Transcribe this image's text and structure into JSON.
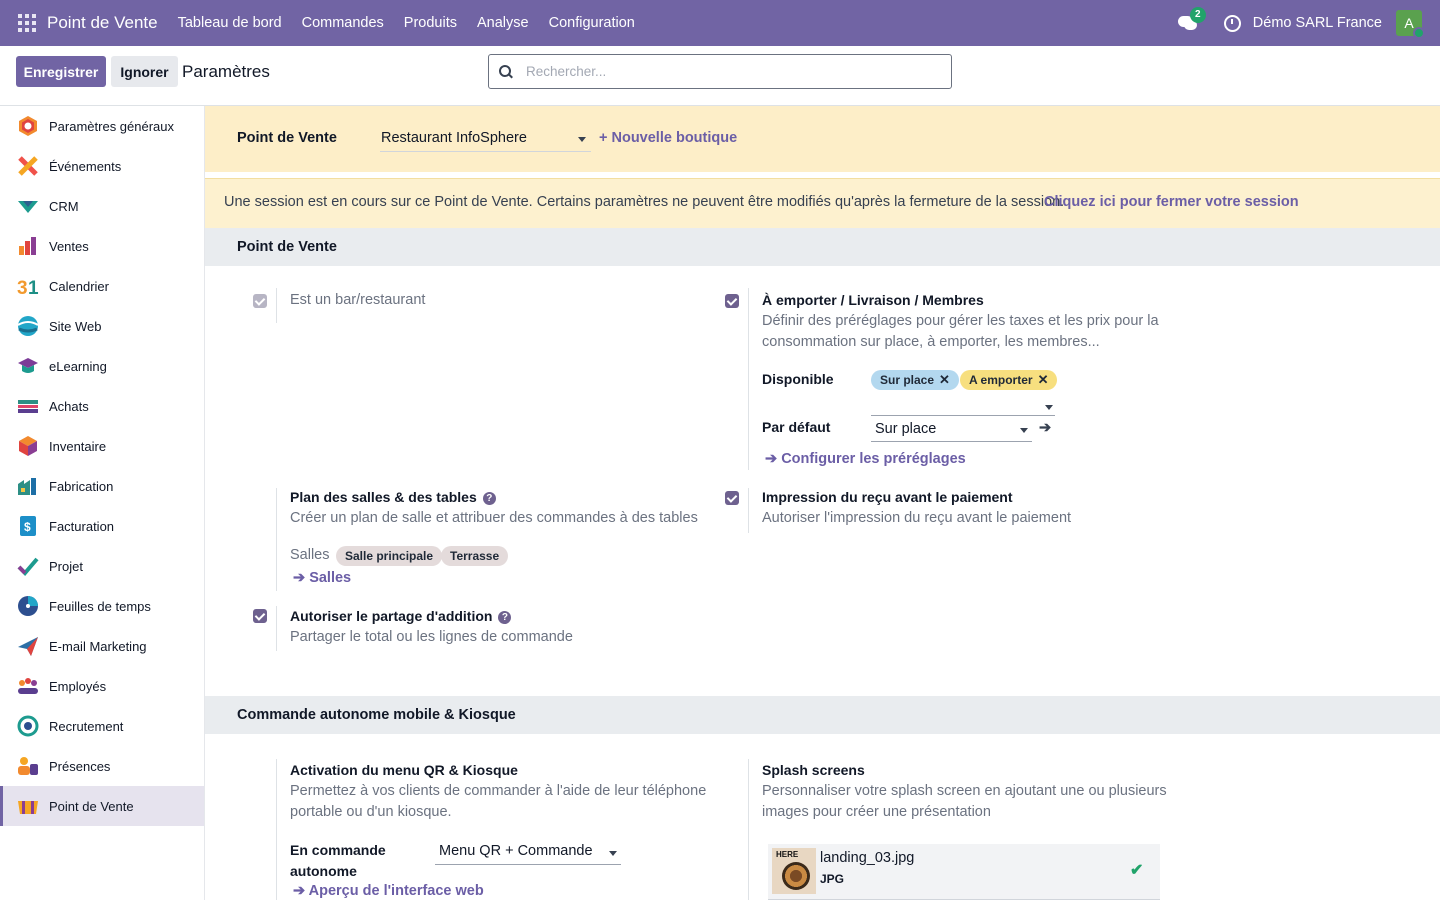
{
  "navbar": {
    "brand": "Point de Vente",
    "menu": [
      "Tableau de bord",
      "Commandes",
      "Produits",
      "Analyse",
      "Configuration"
    ],
    "chat_count": "2",
    "company": "Démo SARL France",
    "avatar_letter": "A"
  },
  "control": {
    "save_label": "Enregistrer",
    "ignore_label": "Ignorer",
    "title": "Paramètres",
    "search_placeholder": "Rechercher..."
  },
  "sidebar": {
    "items": [
      {
        "label": "Paramètres généraux",
        "icon": "settings-icon"
      },
      {
        "label": "Événements",
        "icon": "events-icon"
      },
      {
        "label": "CRM",
        "icon": "crm-icon"
      },
      {
        "label": "Ventes",
        "icon": "sales-icon"
      },
      {
        "label": "Calendrier",
        "icon": "calendar-icon"
      },
      {
        "label": "Site Web",
        "icon": "website-icon"
      },
      {
        "label": "eLearning",
        "icon": "elearning-icon"
      },
      {
        "label": "Achats",
        "icon": "purchase-icon"
      },
      {
        "label": "Inventaire",
        "icon": "inventory-icon"
      },
      {
        "label": "Fabrication",
        "icon": "manufacturing-icon"
      },
      {
        "label": "Facturation",
        "icon": "invoicing-icon"
      },
      {
        "label": "Projet",
        "icon": "project-icon"
      },
      {
        "label": "Feuilles de temps",
        "icon": "timesheet-icon"
      },
      {
        "label": "E-mail Marketing",
        "icon": "email-marketing-icon"
      },
      {
        "label": "Employés",
        "icon": "employees-icon"
      },
      {
        "label": "Recrutement",
        "icon": "recruitment-icon"
      },
      {
        "label": "Présences",
        "icon": "attendance-icon"
      },
      {
        "label": "Point de Vente",
        "icon": "point-of-sale-icon"
      }
    ],
    "active": "Point de Vente"
  },
  "pos_selector": {
    "label": "Point de Vente",
    "value": "Restaurant InfoSphere",
    "new_shop": "+ Nouvelle boutique"
  },
  "warning": {
    "message": "Une session est en cours sur ce Point de Vente. Certains paramètres ne peuvent être modifiés qu'après la fermeture de la session.",
    "link": "Cliquez ici pour fermer votre session"
  },
  "section1": {
    "title": "Point de Vente",
    "bar_restaurant": {
      "label": "Est un bar/restaurant",
      "checked": true
    },
    "takeaway": {
      "title": "À emporter / Livraison / Membres",
      "desc": "Définir des préréglages pour gérer les taxes et les prix pour la consommation sur place, à emporter, les membres...",
      "available_label": "Disponible",
      "tags": [
        "Sur place",
        "A emporter"
      ],
      "default_label": "Par défaut",
      "default_value": "Sur place",
      "configure_link": "Configurer les préréglages",
      "checked": true
    },
    "floor_plan": {
      "title": "Plan des salles & des tables",
      "desc": "Créer un plan de salle et attribuer des commandes à des tables",
      "rooms_label": "Salles",
      "rooms": [
        "Salle principale",
        "Terrasse"
      ],
      "rooms_link": "Salles"
    },
    "receipt": {
      "title": "Impression du reçu avant le paiement",
      "desc": "Autoriser l'impression du reçu avant le paiement",
      "checked": true
    },
    "split_bill": {
      "title": "Autoriser le partage d'addition",
      "desc": "Partager le total ou les lignes de commande",
      "checked": true
    }
  },
  "section2": {
    "title": "Commande autonome mobile & Kiosque",
    "qr": {
      "title": "Activation du menu QR & Kiosque",
      "desc": "Permettez à vos clients de commander à l'aide de leur téléphone portable ou d'un kiosque.",
      "field_label": "En commande autonome",
      "field_value": "Menu QR + Commande",
      "preview_link": "Aperçu de l'interface web"
    },
    "splash": {
      "title": "Splash screens",
      "desc": "Personnaliser votre splash screen en ajoutant une ou plusieurs images pour créer une présentation",
      "file_name": "landing_03.jpg",
      "file_type": "JPG",
      "thumb_text": "HERE"
    }
  }
}
